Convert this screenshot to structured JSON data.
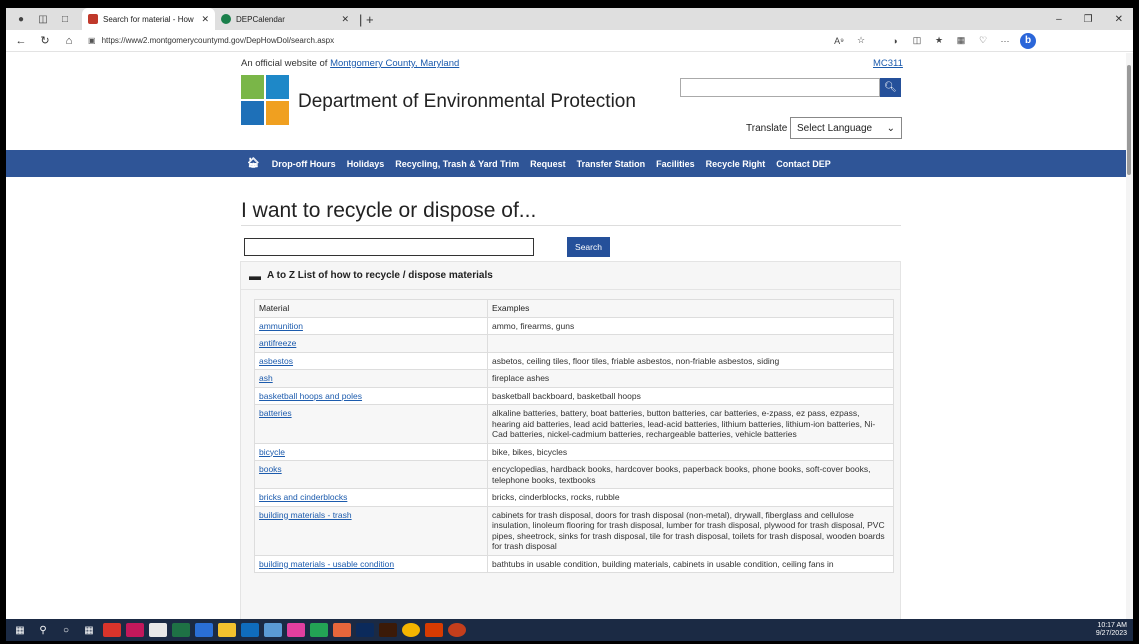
{
  "browser": {
    "tabs": [
      {
        "label": "Search for material - How to recy",
        "favicon_color": "#c0392b"
      },
      {
        "label": "DEPCalendar",
        "favicon_color": "#1a7f4b"
      }
    ],
    "url": "https://www2.montgomerycountymd.gov/DepHowDol/search.aspx"
  },
  "header": {
    "official_text": "An official website of ",
    "official_link": "Montgomery County, Maryland",
    "mc311": "MC311",
    "dept_title": "Department of Environmental Protection",
    "translate_label": "Translate",
    "language_select": "Select Language"
  },
  "nav": {
    "items": [
      "Drop-off Hours",
      "Holidays",
      "Recycling, Trash & Yard Trim",
      "Request",
      "Transfer Station",
      "Facilities",
      "Recycle Right",
      "Contact DEP"
    ]
  },
  "main": {
    "heading": "I want to recycle or dispose of...",
    "search_button": "Search",
    "panel_title": "A to Z List of how to recycle / dispose materials",
    "columns": [
      "Material",
      "Examples"
    ],
    "rows": [
      {
        "material": "ammunition",
        "examples": "ammo, firearms, guns"
      },
      {
        "material": "antifreeze",
        "examples": ""
      },
      {
        "material": "asbestos",
        "examples": "asbetos, ceiling tiles, floor tiles, friable asbestos, non-friable asbestos, siding"
      },
      {
        "material": "ash",
        "examples": "fireplace ashes"
      },
      {
        "material": "basketball hoops and poles",
        "examples": "basketball backboard, basketball hoops"
      },
      {
        "material": "batteries",
        "examples": "alkaline batteries, battery, boat batteries, button batteries, car batteries, e-zpass, ez pass, ezpass, hearing aid batteries, lead acid batteries, lead-acid batteries, lithium batteries, lithium-ion batteries, Ni-Cad batteries, nickel-cadmium batteries, rechargeable batteries, vehicle batteries"
      },
      {
        "material": "bicycle",
        "examples": "bike, bikes, bicycles"
      },
      {
        "material": "books",
        "examples": "encyclopedias, hardback books, hardcover books, paperback books, phone books, soft-cover books, telephone books, textbooks"
      },
      {
        "material": "bricks and cinderblocks",
        "examples": "bricks, cinderblocks, rocks, rubble"
      },
      {
        "material": "building materials - trash",
        "examples": "cabinets for trash disposal, doors for trash disposal (non-metal), drywall, fiberglass and cellulose insulation, linoleum flooring for trash disposal, lumber for trash disposal, plywood for trash disposal, PVC pipes, sheetrock, sinks for trash disposal, tile for trash disposal, toilets for trash disposal, wooden boards for trash disposal"
      },
      {
        "material": "building materials - usable condition",
        "examples": "bathtubs in usable condition, building materials, cabinets in usable condition, ceiling fans in"
      }
    ]
  },
  "taskbar": {
    "time": "10:17 AM",
    "date": "9/27/2023"
  }
}
